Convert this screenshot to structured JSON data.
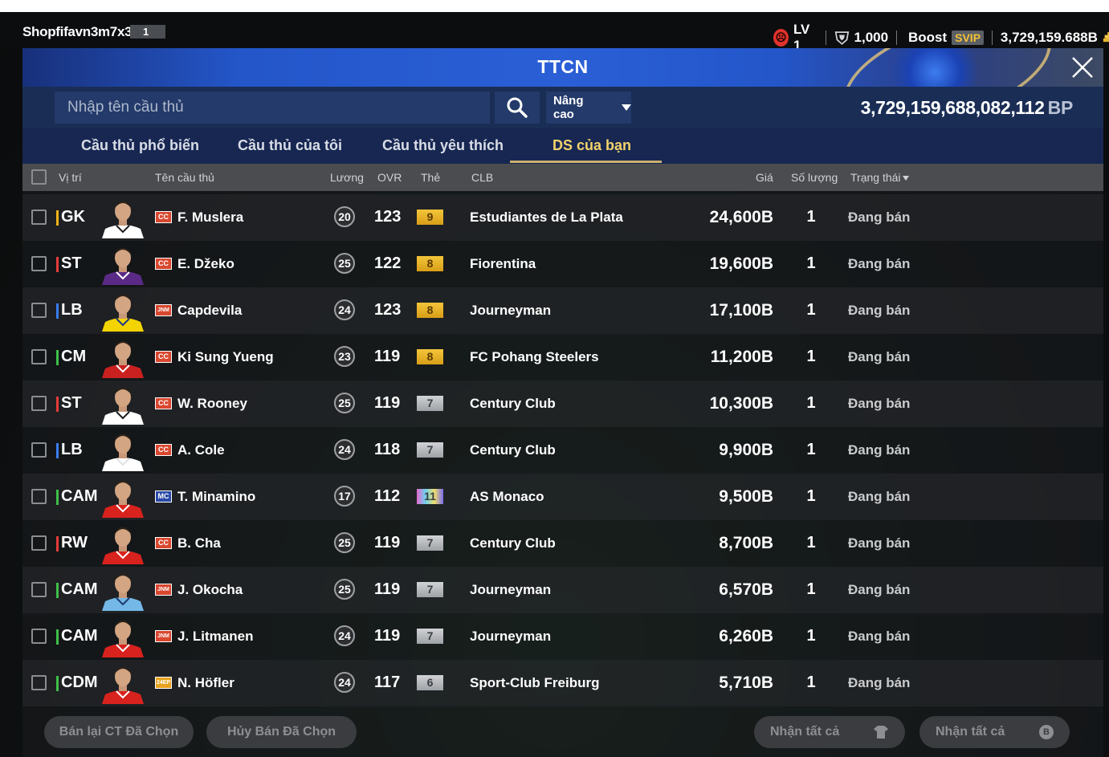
{
  "topbar": {
    "username": "Shopfifavn3m7x3",
    "user_badge": "1",
    "level": "LV 1",
    "trophy_count": "1,000",
    "boost_label": "Boost",
    "svip_label": "SVIP",
    "coin_balance": "3,729,159.688B"
  },
  "window": {
    "title": "TTCN"
  },
  "search": {
    "placeholder": "Nhập tên cầu thủ",
    "advanced_label": "Nâng cao",
    "bp_balance": "3,729,159,688,082,112",
    "bp_unit": "BP"
  },
  "tabs": [
    {
      "label": "Cầu thủ phổ biến",
      "active": false
    },
    {
      "label": "Cầu thủ của tôi",
      "active": false
    },
    {
      "label": "Cầu thủ yêu thích",
      "active": false
    },
    {
      "label": "DS của bạn",
      "active": true
    }
  ],
  "table": {
    "headers": {
      "position": "Vị trí",
      "name": "Tên cầu thủ",
      "salary": "Lương",
      "ovr": "OVR",
      "grade": "Thẻ",
      "club": "CLB",
      "price": "Giá",
      "quantity": "Số lượng",
      "status": "Trạng thái"
    },
    "rows": [
      {
        "position": "GK",
        "pos_color": "#f2b21a",
        "season": "CC",
        "season_color": "#d9472f",
        "name": "F. Muslera",
        "salary": "20",
        "ovr": "123",
        "grade": "9",
        "grade_style": "gold",
        "club": "Estudiantes de La Plata",
        "price": "24,600B",
        "quantity": "1",
        "status": "Đang bán"
      },
      {
        "position": "ST",
        "pos_color": "#e53b3b",
        "season": "CC",
        "season_color": "#d9472f",
        "name": "E. Džeko",
        "salary": "25",
        "ovr": "122",
        "grade": "8",
        "grade_style": "gold",
        "club": "Fiorentina",
        "price": "19,600B",
        "quantity": "1",
        "status": "Đang bán"
      },
      {
        "position": "LB",
        "pos_color": "#3a7cf0",
        "season": "JNM",
        "season_color": "#d9472f",
        "name": "Capdevila",
        "salary": "24",
        "ovr": "123",
        "grade": "8",
        "grade_style": "gold",
        "club": "Journeyman",
        "price": "17,100B",
        "quantity": "1",
        "status": "Đang bán"
      },
      {
        "position": "CM",
        "pos_color": "#3fbf4a",
        "season": "CC",
        "season_color": "#d9472f",
        "name": "Ki Sung Yueng",
        "salary": "23",
        "ovr": "119",
        "grade": "8",
        "grade_style": "gold",
        "club": "FC Pohang Steelers",
        "price": "11,200B",
        "quantity": "1",
        "status": "Đang bán"
      },
      {
        "position": "ST",
        "pos_color": "#e53b3b",
        "season": "CC",
        "season_color": "#d9472f",
        "name": "W. Rooney",
        "salary": "25",
        "ovr": "119",
        "grade": "7",
        "grade_style": "silver",
        "club": "Century Club",
        "price": "10,300B",
        "quantity": "1",
        "status": "Đang bán"
      },
      {
        "position": "LB",
        "pos_color": "#3a7cf0",
        "season": "CC",
        "season_color": "#d9472f",
        "name": "A. Cole",
        "salary": "24",
        "ovr": "118",
        "grade": "7",
        "grade_style": "silver",
        "club": "Century Club",
        "price": "9,900B",
        "quantity": "1",
        "status": "Đang bán"
      },
      {
        "position": "CAM",
        "pos_color": "#3fbf4a",
        "season": "MC",
        "season_color": "#2b4aa8",
        "name": "T. Minamino",
        "salary": "17",
        "ovr": "112",
        "grade": "11",
        "grade_style": "holo",
        "club": "AS Monaco",
        "price": "9,500B",
        "quantity": "1",
        "status": "Đang bán"
      },
      {
        "position": "RW",
        "pos_color": "#e53b3b",
        "season": "CC",
        "season_color": "#d9472f",
        "name": "B. Cha",
        "salary": "25",
        "ovr": "119",
        "grade": "7",
        "grade_style": "silver",
        "club": "Century Club",
        "price": "8,700B",
        "quantity": "1",
        "status": "Đang bán"
      },
      {
        "position": "CAM",
        "pos_color": "#3fbf4a",
        "season": "JNM",
        "season_color": "#d9472f",
        "name": "J. Okocha",
        "salary": "25",
        "ovr": "119",
        "grade": "7",
        "grade_style": "silver",
        "club": "Journeyman",
        "price": "6,570B",
        "quantity": "1",
        "status": "Đang bán"
      },
      {
        "position": "CAM",
        "pos_color": "#3fbf4a",
        "season": "JNM",
        "season_color": "#d9472f",
        "name": "J. Litmanen",
        "salary": "24",
        "ovr": "119",
        "grade": "7",
        "grade_style": "silver",
        "club": "Journeyman",
        "price": "6,260B",
        "quantity": "1",
        "status": "Đang bán"
      },
      {
        "position": "CDM",
        "pos_color": "#3fbf4a",
        "season": "24EP",
        "season_color": "#e8a21f",
        "name": "N. Höfler",
        "salary": "24",
        "ovr": "117",
        "grade": "6",
        "grade_style": "silver",
        "club": "Sport-Club Freiburg",
        "price": "5,710B",
        "quantity": "1",
        "status": "Đang bán"
      }
    ]
  },
  "footer": {
    "resell_selected": "Bán lại CT Đã Chọn",
    "cancel_selected": "Hủy Bán Đã Chọn",
    "claim_all_1": "Nhận tất cả",
    "claim_all_2": "Nhận tất cả"
  },
  "colors": {
    "accent_gold": "#f2d26b",
    "title_blue": "#2a5fd6",
    "grade_gold": "#e3b125",
    "grade_silver": "#b9bcc0"
  }
}
